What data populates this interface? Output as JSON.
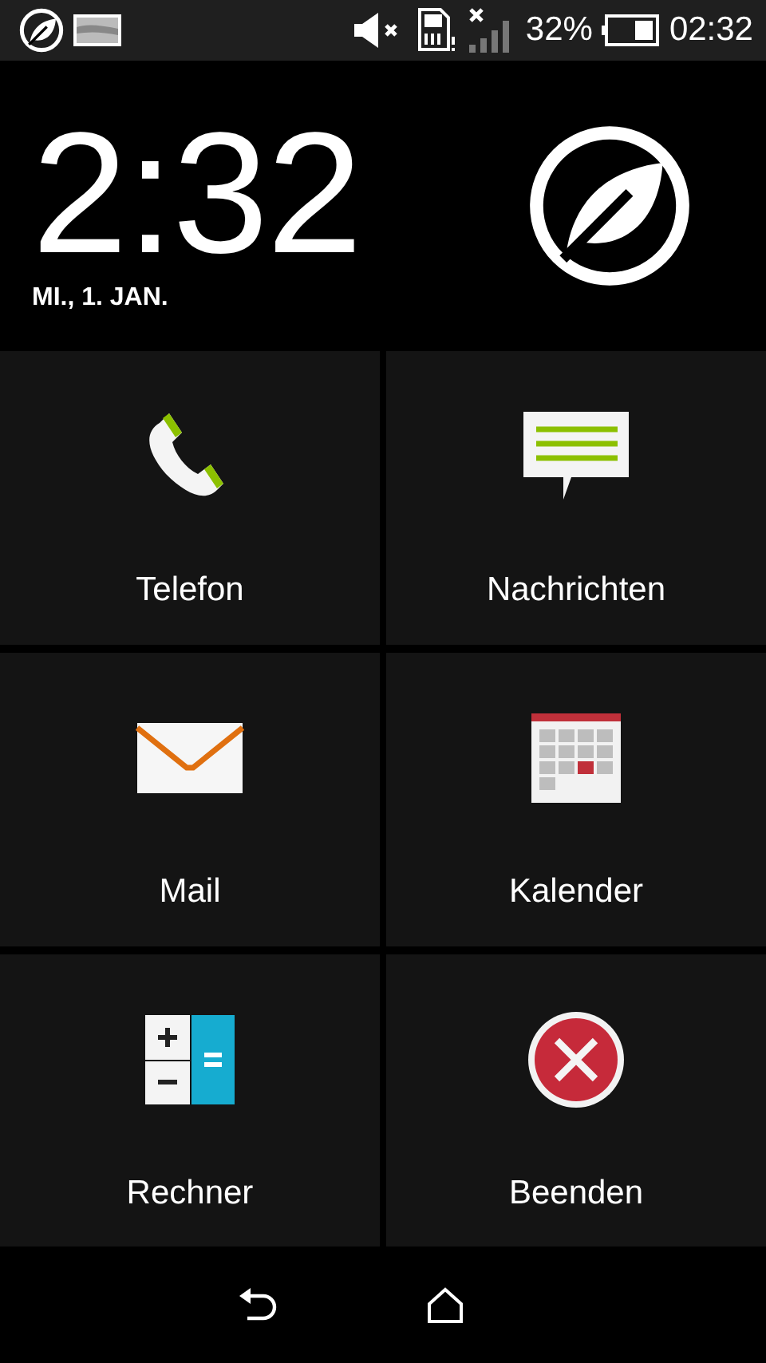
{
  "status_bar": {
    "battery_text": "32%",
    "time": "02:32"
  },
  "clock": {
    "time": "2:32",
    "date": "MI., 1. JAN."
  },
  "tiles": [
    {
      "label": "Telefon",
      "kind": "phone"
    },
    {
      "label": "Nachrichten",
      "kind": "messages"
    },
    {
      "label": "Mail",
      "kind": "mail"
    },
    {
      "label": "Kalender",
      "kind": "calendar"
    },
    {
      "label": "Rechner",
      "kind": "calculator"
    },
    {
      "label": "Beenden",
      "kind": "exit"
    }
  ]
}
